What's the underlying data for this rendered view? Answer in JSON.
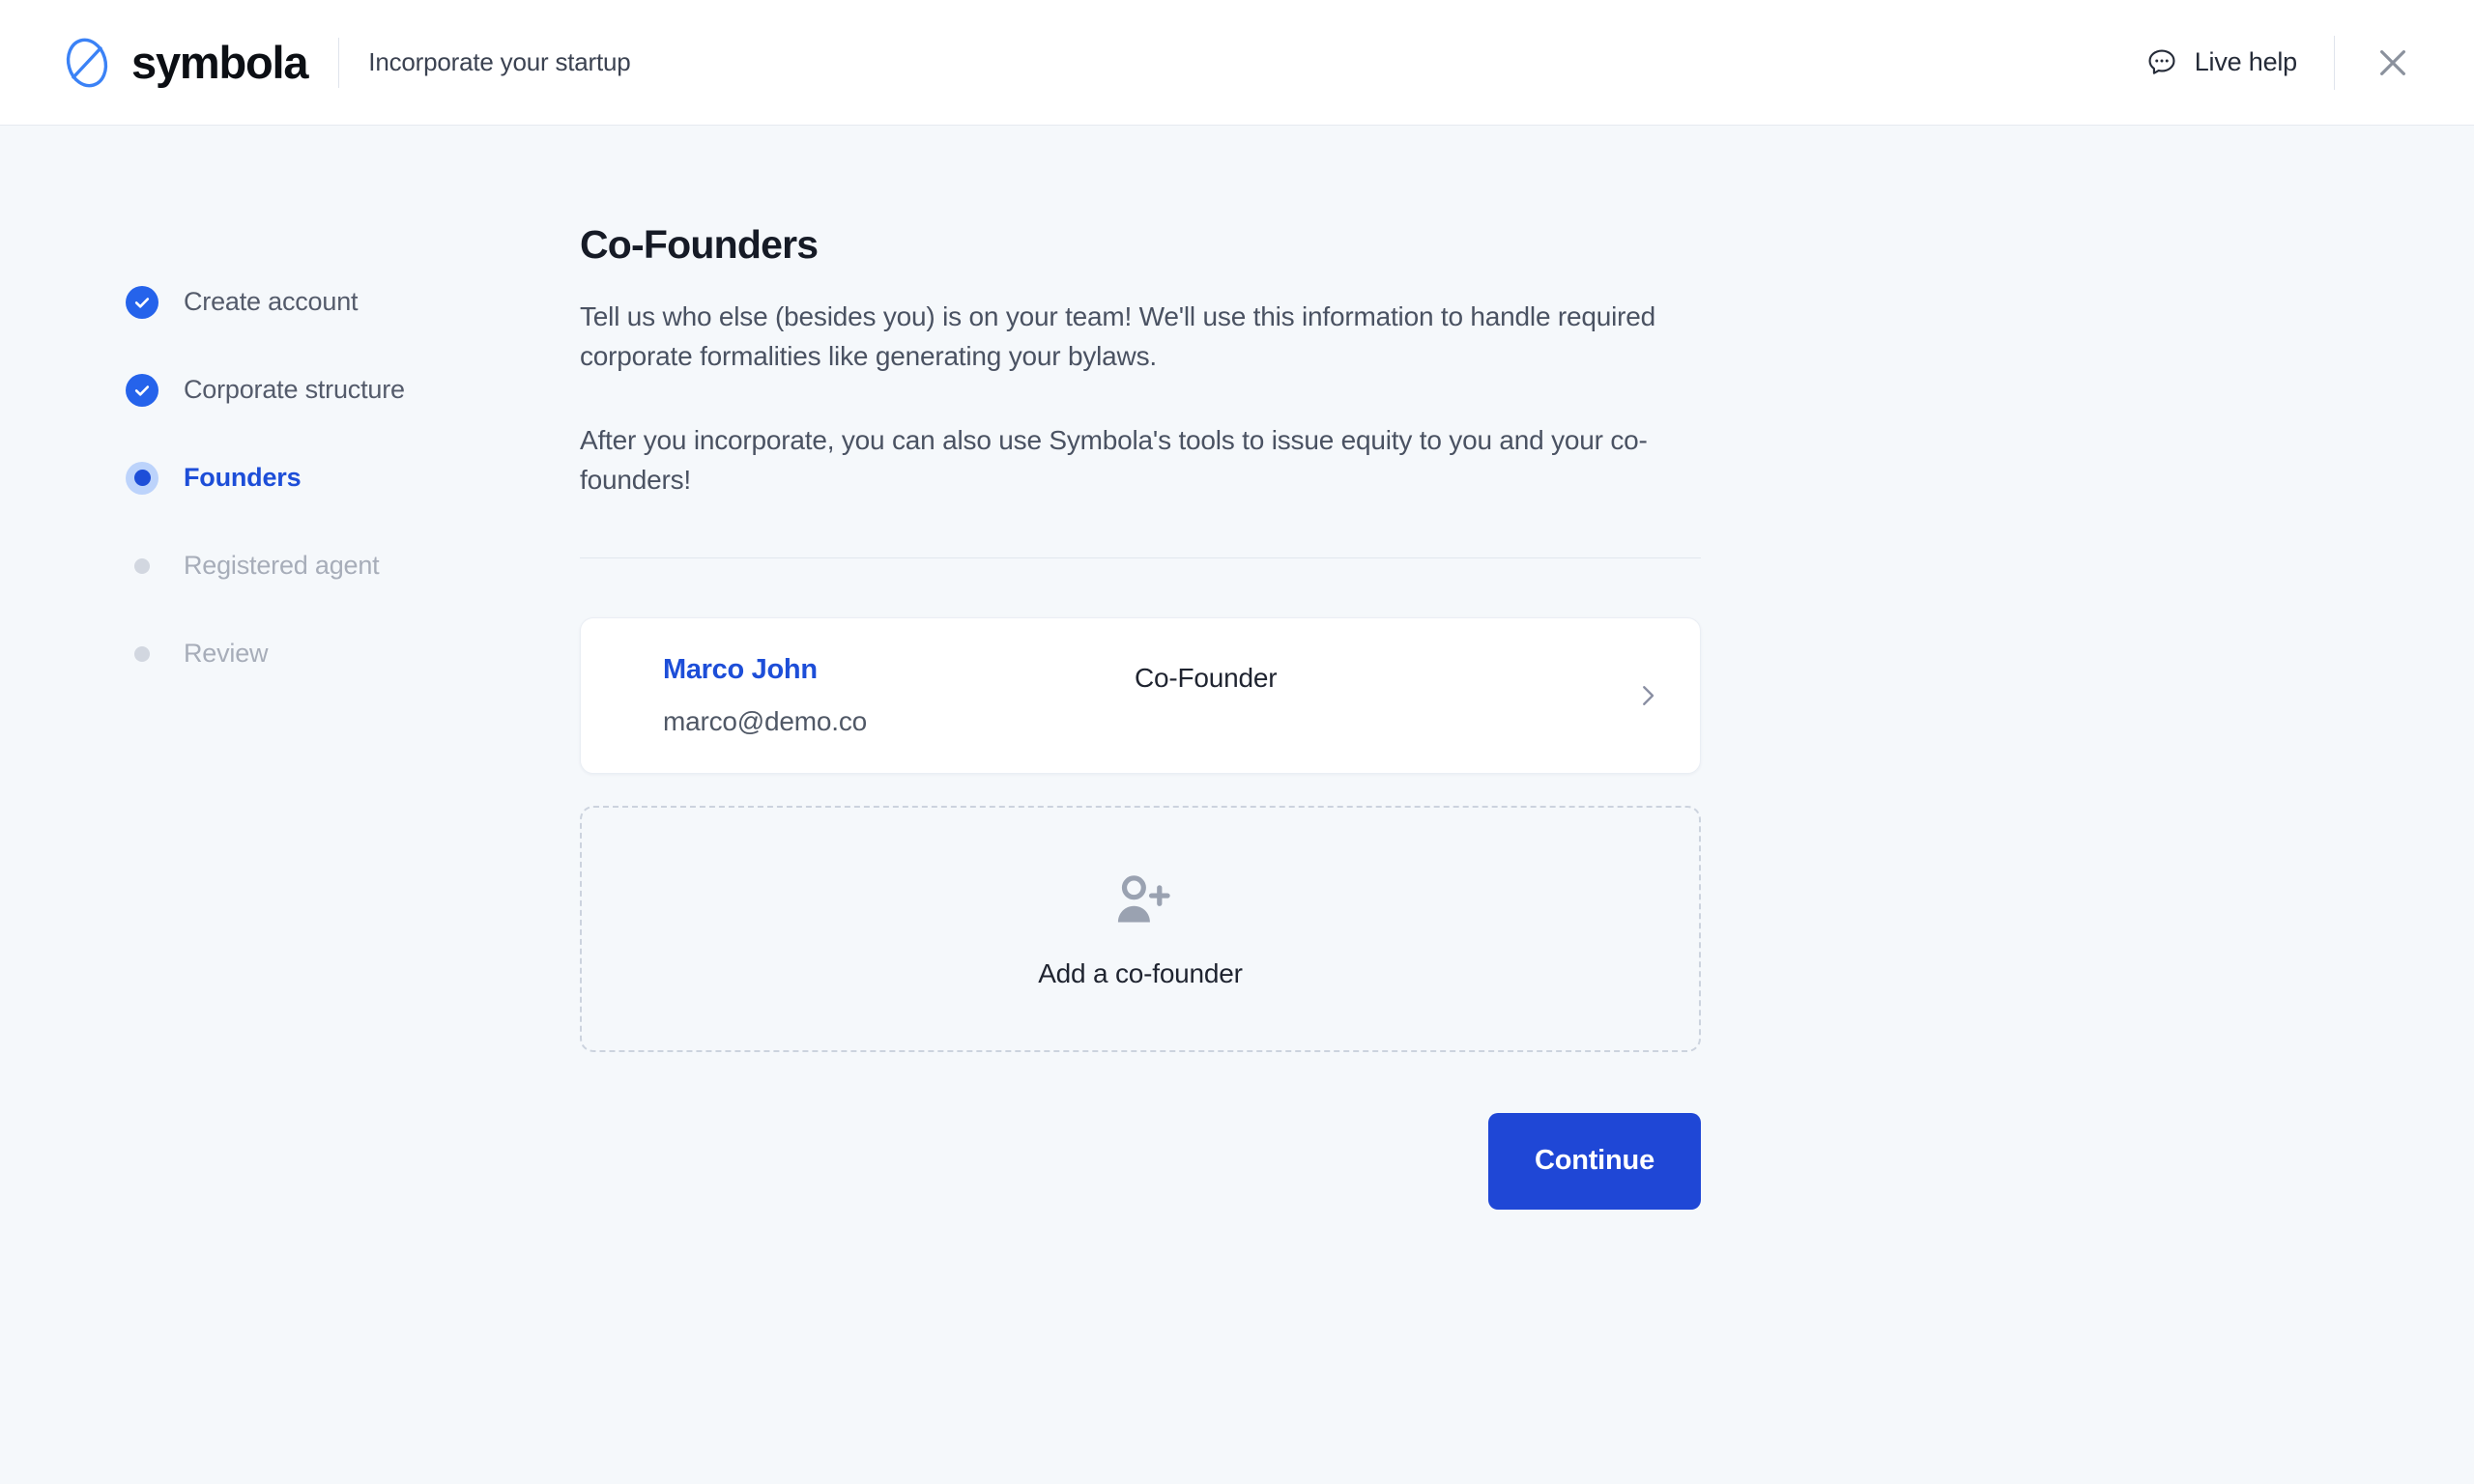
{
  "header": {
    "logo_icon": "symbola-slashed-circle-logo",
    "brand_name": "symbola",
    "subtitle": "Incorporate your startup",
    "live_help_icon": "chat-bubble-icon",
    "live_help_label": "Live help",
    "close_icon": "close-icon"
  },
  "stepper": {
    "steps": [
      {
        "label": "Create account",
        "state": "done"
      },
      {
        "label": "Corporate structure",
        "state": "done"
      },
      {
        "label": "Founders",
        "state": "active"
      },
      {
        "label": "Registered agent",
        "state": "todo"
      },
      {
        "label": "Review",
        "state": "todo"
      }
    ]
  },
  "main": {
    "title": "Co-Founders",
    "paragraph_1": "Tell us who else (besides you) is on your team! We'll use this information to handle required corporate formalities like generating your bylaws.",
    "paragraph_2": "After you incorporate, you can also use Symbola's tools to issue equity to you and your co-founders!",
    "founders": [
      {
        "name": "Marco John",
        "role": "Co-Founder",
        "email": "marco@demo.co",
        "chevron_icon": "chevron-right-icon"
      }
    ],
    "add_founder": {
      "icon": "person-add-icon",
      "label": "Add a co-founder"
    },
    "continue_label": "Continue"
  },
  "colors": {
    "accent_blue": "#1f47d6",
    "step_done_blue": "#2563eb",
    "step_active_blue": "#1d4ed8",
    "page_background": "#f5f8fb",
    "header_background": "#ffffff",
    "card_background": "#ffffff",
    "muted_text": "#a7adb9"
  }
}
